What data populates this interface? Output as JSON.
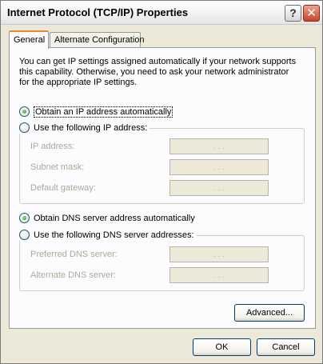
{
  "window": {
    "title": "Internet Protocol (TCP/IP) Properties",
    "help_glyph": "?",
    "close_glyph": "✕"
  },
  "tabs": [
    {
      "label": "General",
      "selected": true
    },
    {
      "label": "Alternate Configuration",
      "selected": false
    }
  ],
  "general": {
    "description": "You can get IP settings assigned automatically if your network supports this capability. Otherwise, you need to ask your network administrator for the appropriate IP settings.",
    "ip_mode": {
      "auto": {
        "label": "Obtain an IP address automatically",
        "checked": true
      },
      "manual": {
        "label": "Use the following IP address:",
        "checked": false
      }
    },
    "ip_fields": [
      {
        "label": "IP address:",
        "value": ". . ."
      },
      {
        "label": "Subnet mask:",
        "value": ". . ."
      },
      {
        "label": "Default gateway:",
        "value": ". . ."
      }
    ],
    "dns_mode": {
      "auto": {
        "label": "Obtain DNS server address automatically",
        "checked": true
      },
      "manual": {
        "label": "Use the following DNS server addresses:",
        "checked": false
      }
    },
    "dns_fields": [
      {
        "label": "Preferred DNS server:",
        "value": ". . ."
      },
      {
        "label": "Alternate DNS server:",
        "value": ". . ."
      }
    ],
    "advanced_label": "Advanced..."
  },
  "buttons": {
    "ok_label": "OK",
    "cancel_label": "Cancel"
  },
  "colors": {
    "dialog_bg": "#ece9d8",
    "panel_bg": "#fcfcfe",
    "disabled_text": "#aca899",
    "tab_highlight": "#e68b2c"
  }
}
